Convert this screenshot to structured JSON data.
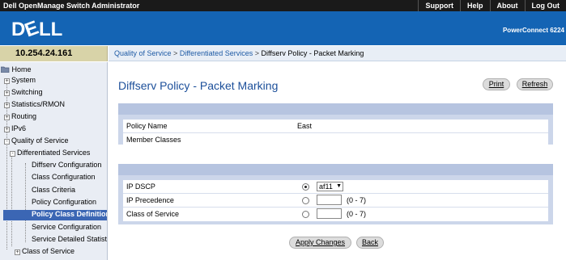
{
  "app": {
    "title": "Dell OpenManage Switch Administrator",
    "top_links": [
      "Support",
      "Help",
      "About",
      "Log Out"
    ],
    "product": "PowerConnect 6224"
  },
  "colors": {
    "header_blue": "#1464b4",
    "title_blue": "#1c4f9a",
    "selected_nav": "#3b66b4"
  },
  "address": "10.254.24.161",
  "breadcrumb": {
    "parts": [
      "Quality of Service",
      "Differentiated Services",
      "Diffserv Policy - Packet Marking"
    ],
    "separator": ">"
  },
  "nav": {
    "home": "Home",
    "items": [
      {
        "label": "System",
        "expander": "+"
      },
      {
        "label": "Switching",
        "expander": "+"
      },
      {
        "label": "Statistics/RMON",
        "expander": "+"
      },
      {
        "label": "Routing",
        "expander": "+"
      },
      {
        "label": "IPv6",
        "expander": "+"
      },
      {
        "label": "Quality of Service",
        "expander": "-"
      },
      {
        "label": "Differentiated Services",
        "expander": "-"
      },
      {
        "label": "Diffserv Configuration"
      },
      {
        "label": "Class Configuration"
      },
      {
        "label": "Class Criteria"
      },
      {
        "label": "Policy Configuration"
      },
      {
        "label": "Policy Class Definition",
        "selected": true
      },
      {
        "label": "Service Configuration"
      },
      {
        "label": "Service Detailed Statistics"
      },
      {
        "label": "Class of Service",
        "expander": "+"
      }
    ]
  },
  "page": {
    "title": "Diffserv Policy - Packet Marking",
    "print_label": "Print",
    "refresh_label": "Refresh"
  },
  "policy": {
    "name_label": "Policy Name",
    "name_value": "East",
    "member_label": "Member Classes",
    "member_value": ""
  },
  "marking": {
    "ip_dscp_label": "IP DSCP",
    "ip_dscp_value": "af11",
    "ip_dscp_selected": true,
    "ip_precedence_label": "IP Precedence",
    "ip_precedence_value": "",
    "ip_precedence_range": "(0 - 7)",
    "cos_label": "Class of Service",
    "cos_value": "",
    "cos_range": "(0 - 7)"
  },
  "actions": {
    "apply_label": "Apply Changes",
    "back_label": "Back"
  }
}
